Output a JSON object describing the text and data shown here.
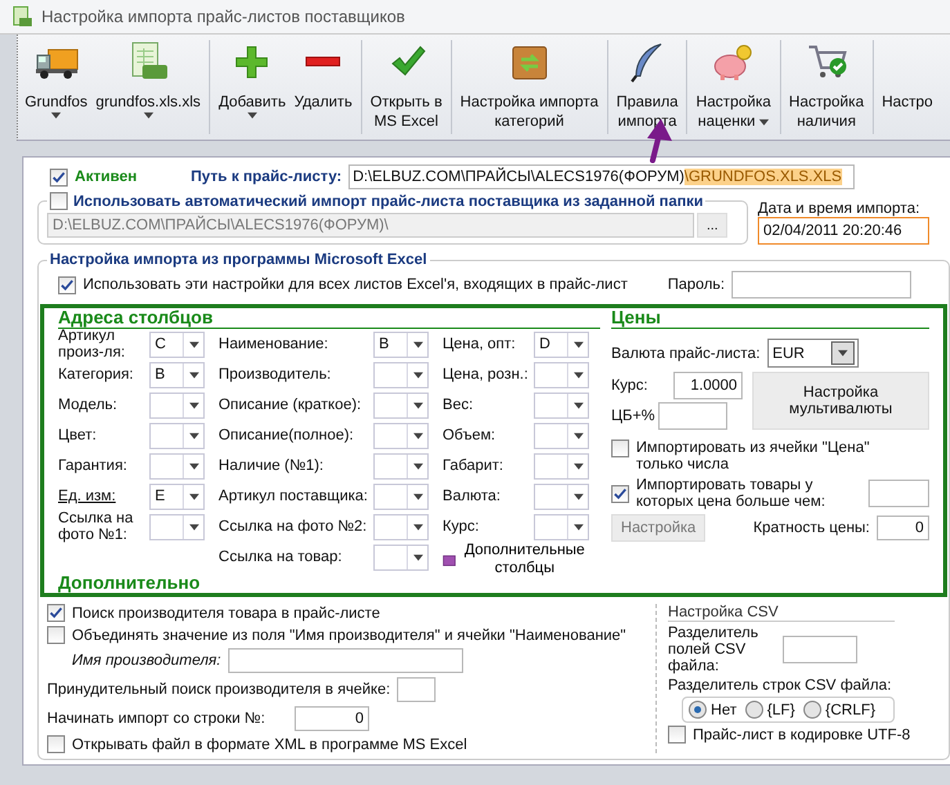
{
  "window": {
    "title": "Настройка импорта прайс-листов поставщиков"
  },
  "toolbar": [
    {
      "lines": [
        "Grundfos"
      ],
      "dropdown": true
    },
    {
      "lines": [
        "grundfos.xls.xls"
      ],
      "dropdown": true
    },
    {
      "lines": [
        "Добавить"
      ],
      "dropdown": true
    },
    {
      "lines": [
        "Удалить"
      ],
      "dropdown": false
    },
    {
      "lines": [
        "Открыть в",
        "MS Excel"
      ],
      "dropdown": false
    },
    {
      "lines": [
        "Настройка импорта",
        "категорий"
      ],
      "dropdown": false
    },
    {
      "lines": [
        "Правила",
        "импорта"
      ],
      "dropdown": false
    },
    {
      "lines": [
        "Настройка",
        "наценки"
      ],
      "dropdown": true
    },
    {
      "lines": [
        "Настройка",
        "наличия"
      ],
      "dropdown": false
    },
    {
      "lines": [
        "Настро"
      ],
      "dropdown": false
    }
  ],
  "general": {
    "active": {
      "label": "Активен",
      "checked": true
    },
    "path_label": "Путь к прайс-листу:",
    "path": "D:\\ELBUZ.COM\\ПРАЙСЫ\\ALECS1976(ФОРУМ)",
    "path_selected": "\\GRUNDFOS.XLS.XLS"
  },
  "auto_import": {
    "toggle": {
      "label": "Использовать автоматический импорт прайс-листа поставщика из заданной папки",
      "checked": false
    },
    "folder": "D:\\ELBUZ.COM\\ПРАЙСЫ\\ALECS1976(ФОРУМ)\\",
    "browse": "...",
    "date_label": "Дата и время импорта:",
    "date": "02/04/2011 20:20:46"
  },
  "excel": {
    "title": "Настройка импорта из программы Microsoft Excel",
    "all_sheets": {
      "label": "Использовать эти настройки для всех листов Excel'я, входящих в прайс-лист",
      "checked": true
    },
    "password_label": "Пароль:"
  },
  "columns": {
    "title": "Адреса столбцов",
    "groups": [
      [
        {
          "label": "Артикул произ-ля:",
          "value": "C",
          "link": false
        },
        {
          "label": "Категория:",
          "value": "B",
          "link": false
        },
        {
          "label": "Модель:",
          "link": false
        },
        {
          "label": "Цвет:",
          "link": false
        },
        {
          "label": "Гарантия:",
          "link": false
        },
        {
          "label": "Ед. изм:",
          "value": "E",
          "link": true
        },
        {
          "label": "Ссылка на фото №1:",
          "link": false
        }
      ],
      [
        {
          "label": "Наименование:",
          "value": "B",
          "link": false
        },
        {
          "label": "Производитель:",
          "link": false
        },
        {
          "label": "Описание (краткое):",
          "link": false
        },
        {
          "label": "Описание(полное):",
          "link": false
        },
        {
          "label": "Наличие (№1):",
          "link": false
        },
        {
          "label": "Артикул поставщика:",
          "link": false
        },
        {
          "label": "Ссылка на фото №2:",
          "link": false
        },
        {
          "label": "Ссылка на товар:",
          "link": false
        }
      ],
      [
        {
          "label": "Цена, опт:",
          "value": "D",
          "link": false
        },
        {
          "label": "Цена, розн.:",
          "link": false
        },
        {
          "label": "Вес:",
          "link": false
        },
        {
          "label": "Объем:",
          "link": false
        },
        {
          "label": "Габарит:",
          "link": false
        },
        {
          "label": "Валюта:",
          "link": false
        },
        {
          "label": "Курс:",
          "link": false
        }
      ]
    ],
    "extra_button": "Дополнительные столбцы"
  },
  "prices": {
    "title": "Цены",
    "currency_label": "Валюта прайс-листа:",
    "currency": "EUR",
    "rate_label": "Курс:",
    "rate": "1.0000",
    "cb_label": "ЦБ+%",
    "multi_button": "Настройка мультивалюты",
    "numbers_only": {
      "label": "Импортировать из ячейки \"Цена\" только числа",
      "checked": false
    },
    "min_price": {
      "label": "Импортировать товары у которых цена больше чем:",
      "checked": true
    },
    "settings_button": {
      "label": "Настройка",
      "disabled": true
    },
    "multiple_label": "Кратность цены:",
    "multiple": "0"
  },
  "additional": {
    "title": "Дополнительно",
    "find_maker": {
      "label": "Поиск производителя товара в прайс-листе",
      "checked": true
    },
    "merge": {
      "label": "Объединять значение из поля \"Имя производителя\" и ячейки \"Наименование\"",
      "checked": false
    },
    "maker_label": "Имя производителя:",
    "forced_label": "Принудительный поиск производителя в ячейке:",
    "start_label": "Начинать импорт со строки №:",
    "start_row": "0",
    "xml": {
      "label": "Открывать файл в формате XML в программе MS Excel",
      "checked": false
    }
  },
  "csv": {
    "title": "Настройка CSV",
    "field_sep_label": "Разделитель полей CSV файла:",
    "row_sep_label": "Разделитель строк CSV файла:",
    "row_separators": [
      {
        "label": "Нет",
        "selected": true
      },
      {
        "label": "{LF}",
        "selected": false
      },
      {
        "label": "{CRLF}",
        "selected": false
      }
    ],
    "utf8": {
      "label": "Прайс-лист в кодировке UTF-8",
      "checked": false
    }
  }
}
